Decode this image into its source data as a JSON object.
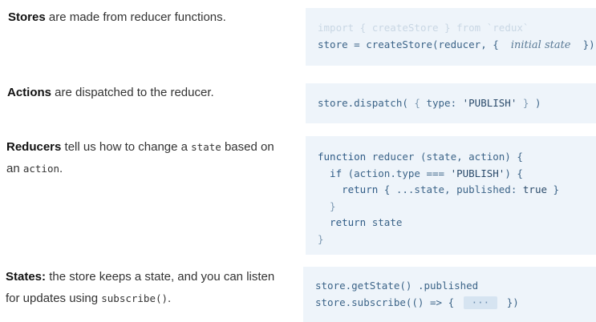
{
  "rows": [
    {
      "term": "Stores",
      "desc": " are made from reducer functions.",
      "code": {
        "line1_import": "import",
        "line1_open": " { ",
        "line1_fn": "createStore",
        "line1_close": " } ",
        "line1_from": "from",
        "line1_module": " `redux`",
        "line2_start": "store = createStore(reducer, {  ",
        "line2_hint": "initial state",
        "line2_end": "  })"
      }
    },
    {
      "term": "Actions",
      "desc": " are dispatched to the reducer.",
      "code": {
        "pre": "store.dispatch(",
        "open": " { ",
        "key": "type: ",
        "str": "'PUBLISH'",
        "close": " }",
        "post": " )"
      }
    },
    {
      "term": "Reducers",
      "desc_before": " tell us how to change a ",
      "inline1": "state",
      "desc_mid": " based on an ",
      "inline2": "action",
      "desc_end": ".",
      "code": {
        "l1_kw": "function",
        "l1_rest": " reducer (state, action) {",
        "l2_kw": "  if",
        "l2_rest": " (action.type === ",
        "l2_str": "'PUBLISH'",
        "l2_end": ") {",
        "l3_kw": "    return",
        "l3_rest": " { ...state, published: ",
        "l3_val": "true",
        "l3_end": " }",
        "l4": "  }",
        "l5_kw": "  return",
        "l5_rest": " state",
        "l6": "}"
      }
    },
    {
      "term": "States:",
      "desc_before": " the store keeps a state, and you can listen for updates using ",
      "inline1": "subscribe()",
      "desc_end": ".",
      "code": {
        "l1_a": "store.getState()",
        "l1_b": " .published",
        "l2_a": "store.subscribe(() => { ",
        "l2_dots": "···",
        "l2_b": " })"
      }
    }
  ]
}
